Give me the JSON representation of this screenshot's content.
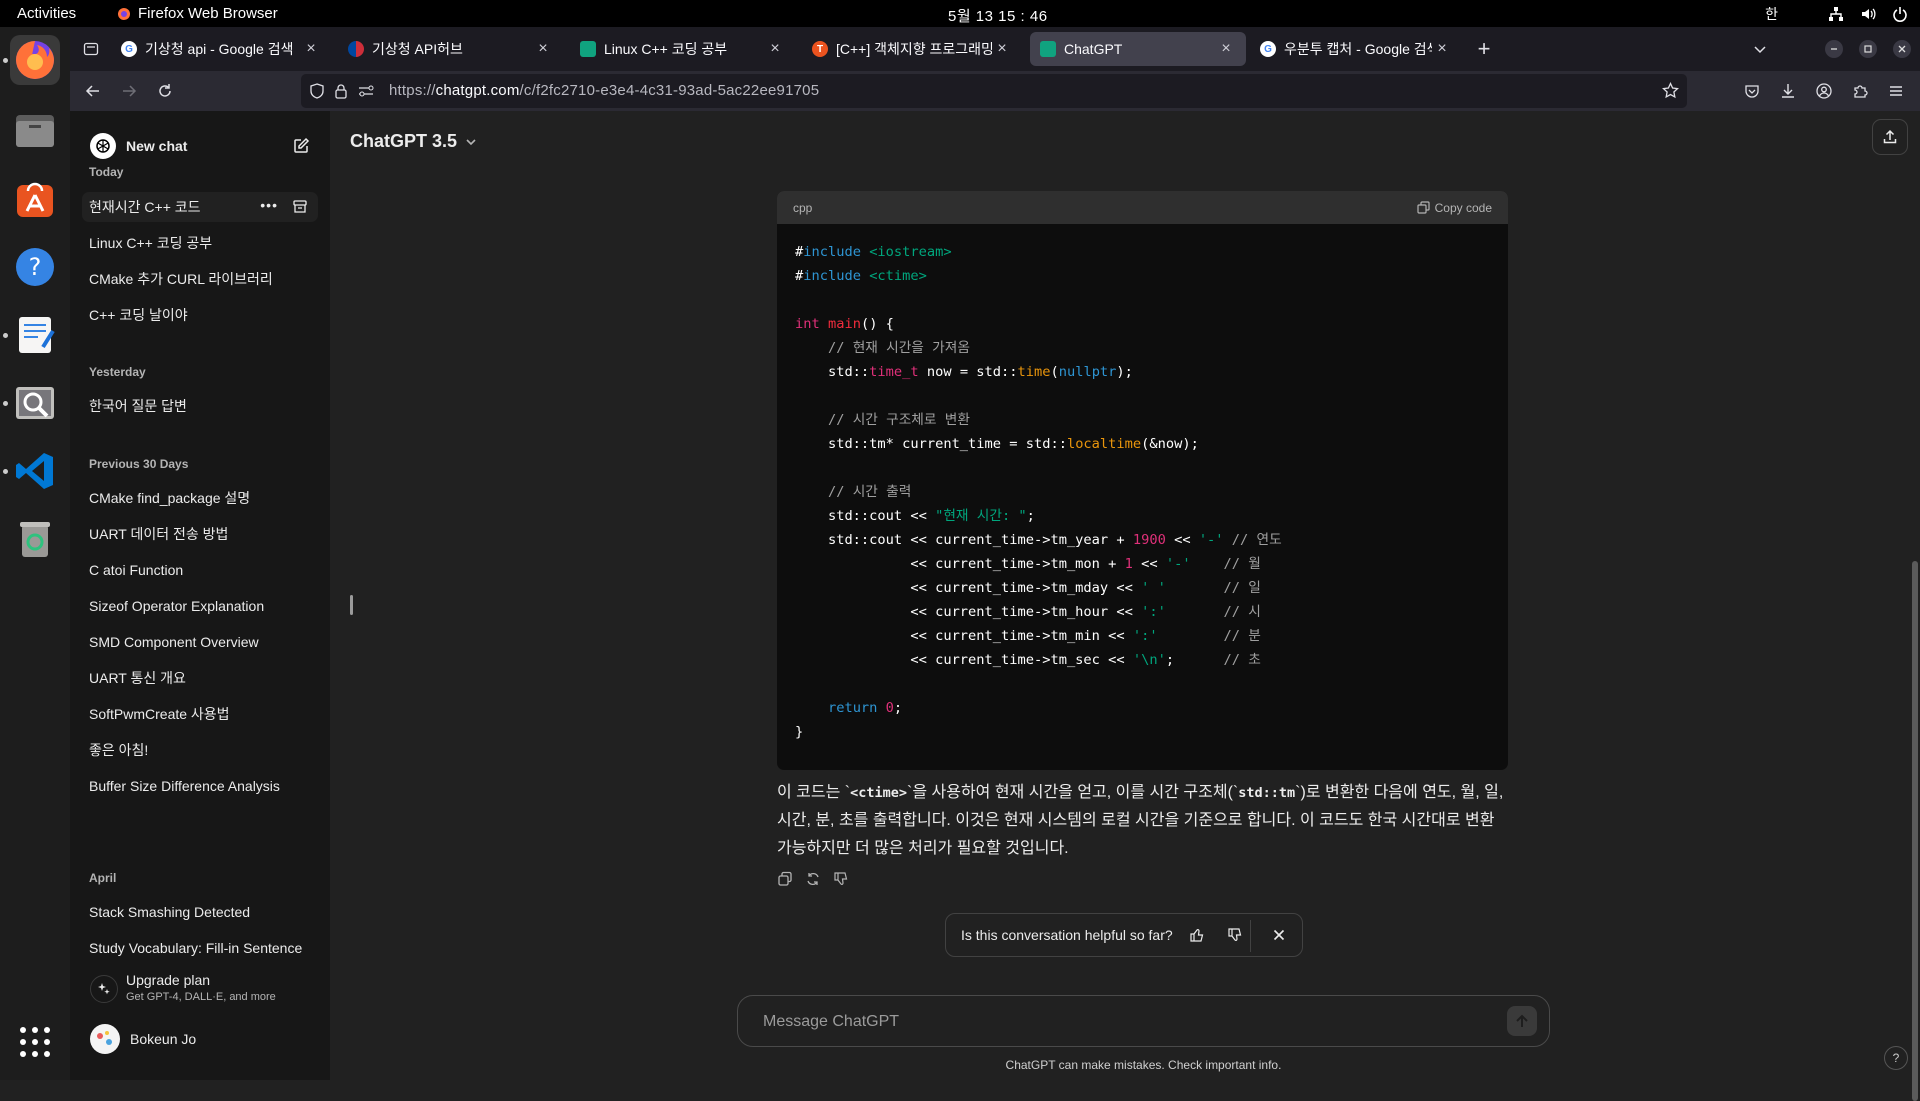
{
  "topbar": {
    "activities": "Activities",
    "app_name": "Firefox Web Browser",
    "clock": "5월 13  15 : 46",
    "ime": "한"
  },
  "tabs": [
    {
      "title": "기상청 api - Google 검색",
      "icon": "google-icon"
    },
    {
      "title": "기상청 API허브",
      "icon": "kma-icon"
    },
    {
      "title": "Linux C++ 코딩 공부",
      "icon": "chatgpt-icon"
    },
    {
      "title": "[C++] 객체지향 프로그래밍",
      "icon": "tistory-icon"
    },
    {
      "title": "ChatGPT",
      "icon": "chatgpt-icon"
    },
    {
      "title": "우분투 캡처 - Google 검색",
      "icon": "google-icon"
    }
  ],
  "urlbar": {
    "prefix": "https://",
    "domain": "chatgpt.com",
    "path": "/c/f2fc2710-e3e4-4c31-93ad-5ac22ee91705"
  },
  "sidebar": {
    "new_chat": "New chat",
    "sections": [
      {
        "label": "Today",
        "items": [
          "현재시간 C++ 코드",
          "Linux C++ 코딩 공부",
          "CMake 추가 CURL 라이브러리",
          "C++ 코딩 날이야"
        ]
      },
      {
        "label": "Yesterday",
        "items": [
          "한국어 질문 답변"
        ]
      },
      {
        "label": "Previous 30 Days",
        "items": [
          "CMake find_package 설명",
          "UART 데이터 전송 방법",
          "C atoi Function",
          "Sizeof Operator Explanation",
          "SMD Component Overview",
          "UART 통신 개요",
          "SoftPwmCreate 사용법",
          "좋은 아침!",
          "Buffer Size Difference Analysis"
        ]
      },
      {
        "label": "April",
        "items": [
          "Stack Smashing Detected",
          "Study Vocabulary: Fill-in Sentence"
        ]
      }
    ],
    "upgrade_title": "Upgrade plan",
    "upgrade_subtitle": "Get GPT-4, DALL·E, and more",
    "user_name": "Bokeun Jo"
  },
  "main": {
    "model": "ChatGPT 3.5",
    "code_lang": "cpp",
    "copy_code": "Copy code",
    "code_lines": [
      "#include <iostream>",
      "#include <ctime>",
      "",
      "int main() {",
      "    // 현재 시간을 가져옴",
      "    std::time_t now = std::time(nullptr);",
      "",
      "    // 시간 구조체로 변환",
      "    std::tm* current_time = std::localtime(&now);",
      "",
      "    // 시간 출력",
      "    std::cout << \"현재 시간: \";",
      "    std::cout << current_time->tm_year + 1900 << '-' // 연도",
      "              << current_time->tm_mon + 1 << '-'    // 월",
      "              << current_time->tm_mday << ' '       // 일",
      "              << current_time->tm_hour << ':'       // 시",
      "              << current_time->tm_min << ':'        // 분",
      "              << current_time->tm_sec << '\\n';      // 초",
      "",
      "    return 0;",
      "}"
    ],
    "answer_part1": "이 코드는 `",
    "answer_code1": "<ctime>",
    "answer_part2": "`을 사용하여 현재 시간을 얻고, 이를 시간 구조체(`",
    "answer_code2": "std::tm",
    "answer_part3": "`)로 변환한 다음에 연도, 월, 일, 시간, 분, 초를 출력합니다. 이것은 현재 시스템의 로컬 시간을 기준으로 합니다. 이 코드도 한국 시간대로 변환 가능하지만 더 많은 처리가 필요할 것입니다.",
    "feedback_question": "Is this conversation helpful so far?",
    "composer_placeholder": "Message ChatGPT",
    "disclaimer": "ChatGPT can make mistakes. Check important info.",
    "help": "?"
  }
}
